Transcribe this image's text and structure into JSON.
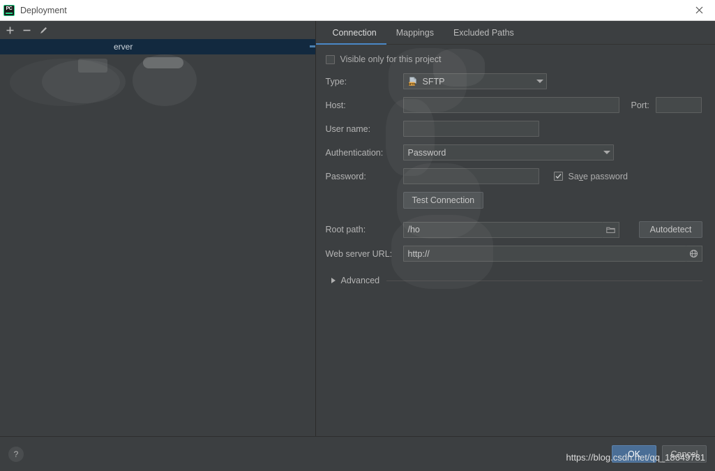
{
  "window": {
    "title": "Deployment",
    "app_icon": "pycharm-icon",
    "close_label": "✕"
  },
  "left_panel": {
    "toolbar": [
      {
        "name": "add-server-button",
        "icon": "plus-icon",
        "label": "+"
      },
      {
        "name": "remove-server-button",
        "icon": "minus-icon",
        "label": "−"
      },
      {
        "name": "edit-server-button",
        "icon": "pencil-icon",
        "label": ""
      }
    ],
    "servers": [
      {
        "label": "erver",
        "selected": true
      }
    ]
  },
  "tabs": [
    {
      "label": "Connection",
      "active": true
    },
    {
      "label": "Mappings",
      "active": false
    },
    {
      "label": "Excluded Paths",
      "active": false
    }
  ],
  "form": {
    "visible_only_checkbox": {
      "label": "Visible only for this project",
      "checked": false
    },
    "type": {
      "label": "Type:",
      "value": "SFTP",
      "icon": "sftp-icon"
    },
    "host": {
      "label": "Host:",
      "value": ""
    },
    "port": {
      "label": "Port:",
      "value": ""
    },
    "user_name": {
      "label": "User name:",
      "value": ""
    },
    "authentication": {
      "label": "Authentication:",
      "value": "Password"
    },
    "password": {
      "label": "Password:",
      "value": ""
    },
    "save_password": {
      "label_pre": "Sa",
      "label_mnemonic": "v",
      "label_post": "e password",
      "checked": true
    },
    "test_connection_button": {
      "label": "Test Connection"
    },
    "root_path": {
      "label": "Root path:",
      "value": "/ho",
      "browse_icon": "folder-icon"
    },
    "autodetect_button": {
      "label": "Autodetect"
    },
    "web_server_url": {
      "label": "Web server URL:",
      "value": "http://",
      "browse_icon": "globe-icon"
    },
    "advanced": {
      "label": "Advanced",
      "expanded": false,
      "icon": "chevron-right-icon"
    }
  },
  "bottom": {
    "help_button": {
      "label": "?",
      "icon": "help-icon"
    },
    "ok_button": {
      "label": "OK"
    },
    "cancel_button": {
      "label": "Cancel"
    },
    "watermark": "https://blog.csdn.net/qq_18649781"
  },
  "colors": {
    "accent": "#4a88c7",
    "dialog_bg": "#3c3f41",
    "titlebar_bg": "#ffffff",
    "selection_bg": "#12293f",
    "ok_button_bg": "#4a6e96"
  }
}
